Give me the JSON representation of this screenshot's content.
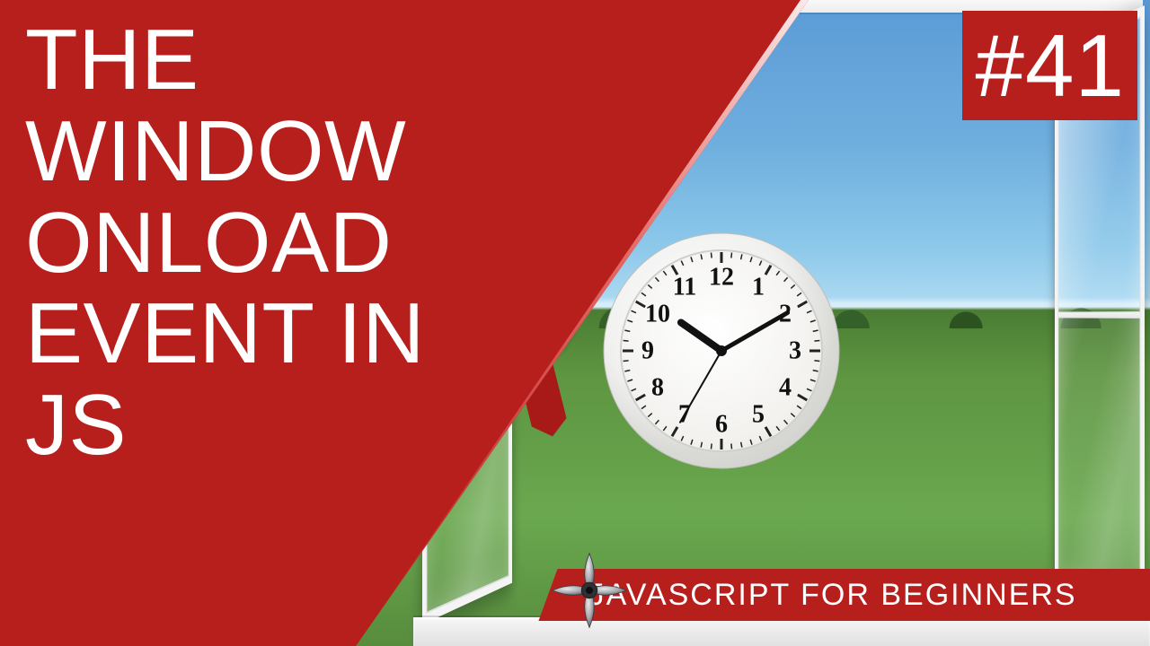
{
  "title_lines": [
    "THE WINDOW",
    "ONLOAD",
    "EVENT IN",
    "JS"
  ],
  "episode": "#41",
  "series": "JAVASCRIPT FOR BEGINNERS",
  "clock": {
    "numerals": [
      "12",
      "1",
      "2",
      "3",
      "4",
      "5",
      "6",
      "7",
      "8",
      "9",
      "10",
      "11"
    ],
    "hour": 10,
    "minute": 10,
    "second": 35
  },
  "colors": {
    "brand_red": "#b61f1c"
  }
}
